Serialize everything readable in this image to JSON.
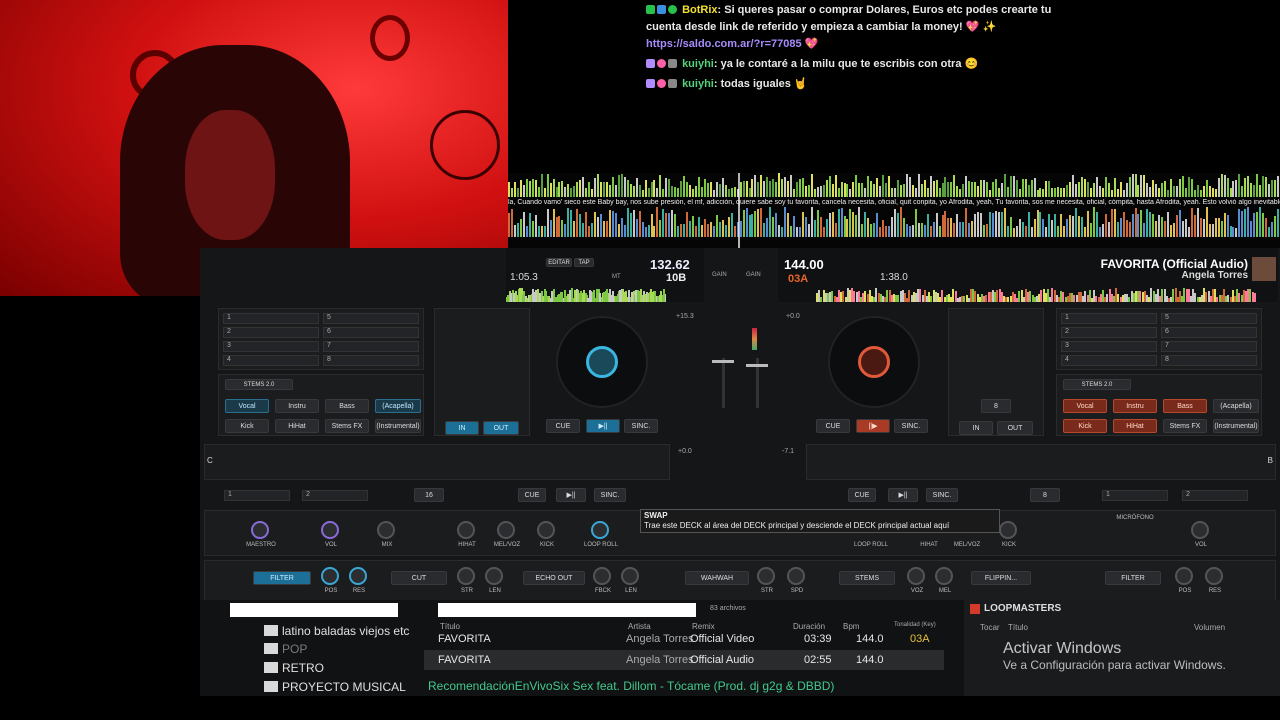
{
  "chat": {
    "messages": [
      {
        "user": "BotRix",
        "text": ": Si queres pasar o comprar Dolares, Euros etc podes crearte tu"
      },
      {
        "user": "",
        "text": "cuenta desde link de referido y empieza a cambiar la money! 💖 ✨"
      },
      {
        "user": "",
        "text": "https://saldo.com.ar/?r=77085 💖",
        "is_link": true
      },
      {
        "user": "kuiyhi",
        "text": ": ya le contaré a la milu que te escribis con otra 😊"
      },
      {
        "user": "kuiyhi",
        "text": ": todas iguales 🤘"
      }
    ]
  },
  "waveform": {
    "lyrics": "la, Cuando vamo' sieco este Baby bay, nos sube presión, el mf, adicción, quiere sabe soy tu favorita, cancela necesita, oficial, quit conpita, yo Afrodita, yeah, Tu favorita, sos me necesita, oficial, cómpita, hasta Afrodita, yeah.  Esto volvió algo inevitable"
  },
  "left_deck": {
    "time": "1:05.3",
    "edit_label": "EDITAR",
    "tap_label": "TAP",
    "bpm": "132.62",
    "key": "10B",
    "mt_label": "MT",
    "pitch": "+15.3",
    "cue_label": "CUE",
    "play_label": "▶||",
    "sync_label": "SINC.",
    "in_label": "IN",
    "out_label": "OUT",
    "stems_preset": "STEMS 2.0",
    "stems_row1": [
      "Vocal",
      "Instru",
      "Bass",
      "(Acapella)"
    ],
    "stems_row2": [
      "Kick",
      "HiHat",
      "Stems FX",
      "(Instrumental)"
    ],
    "hotcues": [
      "1",
      "2",
      "3",
      "4",
      "5",
      "6",
      "7",
      "8"
    ],
    "loop_size": "16",
    "sampler_slots": [
      "1",
      "2"
    ],
    "deck_letter": "C"
  },
  "right_deck": {
    "bpm": "144.00",
    "key": "03A",
    "time": "1:38.0",
    "title": "FAVORITA (Official Audio)",
    "artist": "Angela Torres",
    "pitch": "+0.0",
    "pitch2": "-7.1",
    "cue_label": "CUE",
    "play_label": "||▶",
    "sync_label": "SINC.",
    "in_label": "IN",
    "out_label": "OUT",
    "stems_preset": "STEMS 2.0",
    "stems_row1": [
      "Vocal",
      "Instru",
      "Bass",
      "(Acapella)"
    ],
    "stems_row2": [
      "Kick",
      "HiHat",
      "Stems FX",
      "(Instrumental)"
    ],
    "hotcues": [
      "1",
      "2",
      "3",
      "4",
      "5",
      "6",
      "7",
      "8"
    ],
    "loop_size": "8",
    "loop_size_b": "8",
    "sampler_slots": [
      "1",
      "2"
    ],
    "deck_letter": "B"
  },
  "center_labels": {
    "gain": "GAIN",
    "pitch_mid": "+0.0"
  },
  "effects": {
    "left_labels": [
      "MAESTRO",
      "VOL",
      "MIX",
      "HIHAT",
      "MEL/VOZ",
      "KICK",
      "LOOP ROLL"
    ],
    "right_labels": [
      "LOOP ROLL",
      "HIHAT",
      "MEL/VOZ",
      "KICK",
      "VOL"
    ],
    "microphone": "MICRÓFONO",
    "left_fx": [
      "FILTER",
      "CUT",
      "ECHO OUT"
    ],
    "left_fx_knobs": [
      "POS",
      "RES",
      "STR",
      "LEN",
      "FBCK",
      "LEN"
    ],
    "center_fx": "WAHWAH",
    "center_fx_knobs": [
      "STR",
      "SPD"
    ],
    "right_fx": [
      "STEMS",
      "FLIPPIN...",
      "FILTER"
    ],
    "right_fx_knobs": [
      "VOZ",
      "MEL",
      "POS",
      "RES"
    ]
  },
  "tooltip": {
    "title": "SWAP",
    "text": "Trae este DECK al área del DECK principal y desciende el DECK principal actual aquí"
  },
  "browser": {
    "file_count": "83 archivos",
    "folders": [
      "latino baladas viejos etc",
      "POP",
      "RETRO",
      "PROYECTO MUSICAL"
    ],
    "columns": [
      "Título",
      "Artista",
      "Remix",
      "Duración",
      "Bpm",
      "Tonalidad (Key)"
    ],
    "rows": [
      {
        "title": "FAVORITA",
        "artist": "Angela Torres",
        "remix": "Official Video",
        "duration": "03:39",
        "bpm": "144.0",
        "key": "03A"
      },
      {
        "title": "FAVORITA",
        "artist": "Angela Torres",
        "remix": "Official Audio",
        "duration": "02:55",
        "bpm": "144.0",
        "key": ""
      }
    ],
    "now_playing": "RecomendaciónEnVivoSix Sex feat. Dillom - Tócame (Prod. dj g2g & DBBD)",
    "sampler_title": "LOOPMASTERS",
    "sampler_cols": [
      "Tocar",
      "Título",
      "Volumen"
    ]
  },
  "windows_activation": {
    "title": "Activar Windows",
    "subtitle": "Ve a Configuración para activar Windows."
  },
  "colors": {
    "blue_accent": "#1c6f96",
    "red_accent": "#a83a26",
    "now_playing": "#42c98d"
  }
}
